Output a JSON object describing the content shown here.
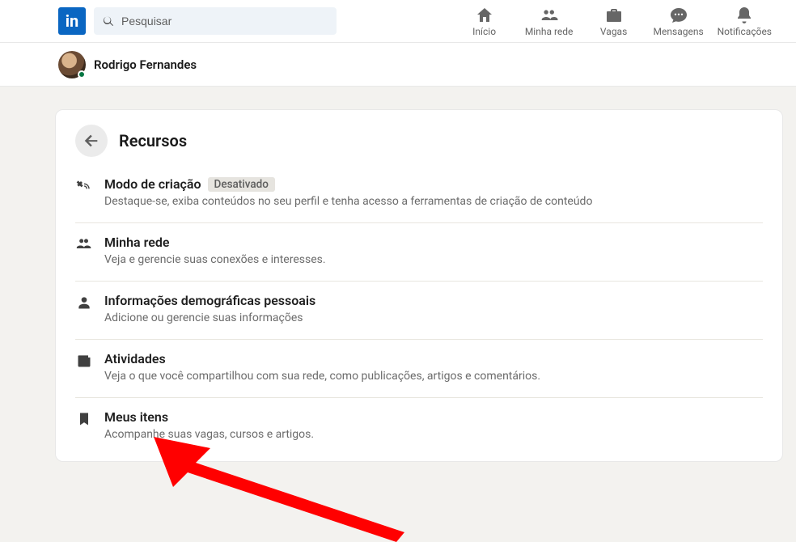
{
  "brand": {
    "logo_text": "in"
  },
  "search": {
    "placeholder": "Pesquisar"
  },
  "nav": {
    "home": "Início",
    "network": "Minha rede",
    "jobs": "Vagas",
    "messages": "Mensagens",
    "notifications": "Notificações"
  },
  "user": {
    "name": "Rodrigo Fernandes"
  },
  "page_title": "Recursos",
  "resources": [
    {
      "icon": "satellite",
      "title": "Modo de criação",
      "badge": "Desativado",
      "desc": "Destaque-se, exiba conteúdos no seu perfil e tenha acesso a ferramentas de criação de conteúdo"
    },
    {
      "icon": "people",
      "title": "Minha rede",
      "desc": "Veja e gerencie suas conexões e interesses."
    },
    {
      "icon": "person",
      "title": "Informações demográficas pessoais",
      "desc": "Adicione ou gerencie suas informações"
    },
    {
      "icon": "newspaper",
      "title": "Atividades",
      "desc": "Veja o que você compartilhou com sua rede, como publicações, artigos e comentários."
    },
    {
      "icon": "bookmark",
      "title": "Meus itens",
      "desc": "Acompanhe suas vagas, cursos e artigos."
    }
  ]
}
